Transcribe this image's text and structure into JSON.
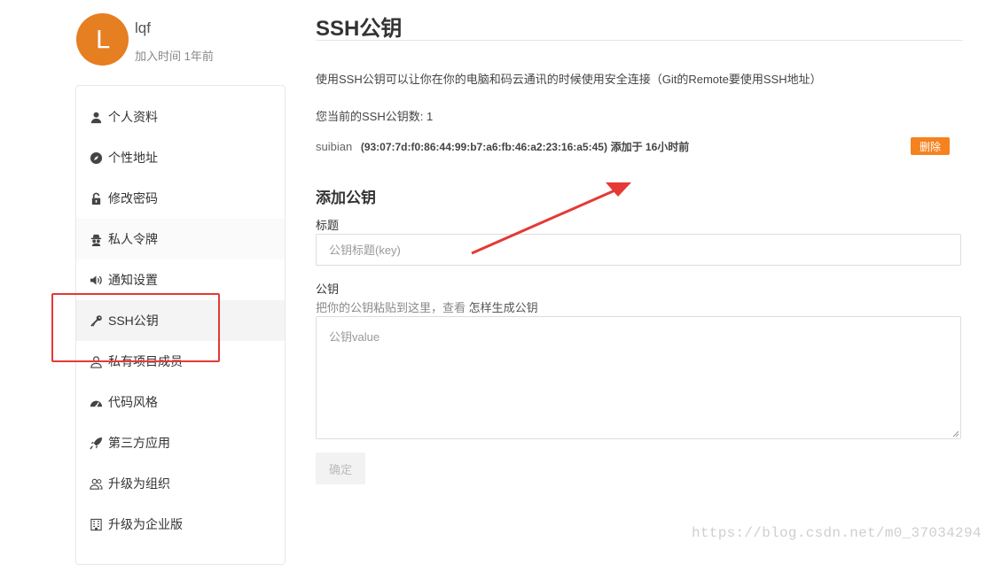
{
  "profile": {
    "avatar_letter": "L",
    "username": "lqf",
    "joined": "加入时间 1年前"
  },
  "sidebar": {
    "items": [
      {
        "label": "个人资料",
        "icon": "user-icon"
      },
      {
        "label": "个性地址",
        "icon": "compass-icon"
      },
      {
        "label": "修改密码",
        "icon": "unlock-icon"
      },
      {
        "label": "私人令牌",
        "icon": "spy-icon"
      },
      {
        "label": "通知设置",
        "icon": "volume-icon"
      },
      {
        "label": "SSH公钥",
        "icon": "key-icon",
        "active": true
      },
      {
        "label": "私有项目成员",
        "icon": "users-icon"
      },
      {
        "label": "代码风格",
        "icon": "dashboard-icon"
      },
      {
        "label": "第三方应用",
        "icon": "rocket-icon"
      },
      {
        "label": "升级为组织",
        "icon": "group-icon"
      },
      {
        "label": "升级为企业版",
        "icon": "building-icon"
      }
    ]
  },
  "main": {
    "title": "SSH公钥",
    "description": "使用SSH公钥可以让你在你的电脑和码云通讯的时候使用安全连接（Git的Remote要使用SSH地址）",
    "key_count": "您当前的SSH公钥数: 1",
    "keys": [
      {
        "name": "suibian",
        "fingerprint": "(93:07:7d:f0:86:44:99:b7:a6:fb:46:a2:23:16:a5:45)",
        "added": "添加于 16小时前",
        "delete_label": "删除"
      }
    ],
    "add_heading": "添加公钥",
    "title_label": "标题",
    "title_placeholder": "公钥标题(key)",
    "key_label": "公钥",
    "key_hint": "把你的公钥粘贴到这里，查看",
    "key_hint_link": "怎样生成公钥",
    "key_placeholder": "公钥value",
    "submit_label": "确定"
  },
  "watermark": "https://blog.csdn.net/m0_37034294",
  "colors": {
    "accent": "#f5821f",
    "avatar": "#e67e22",
    "annotation": "#e53935"
  }
}
